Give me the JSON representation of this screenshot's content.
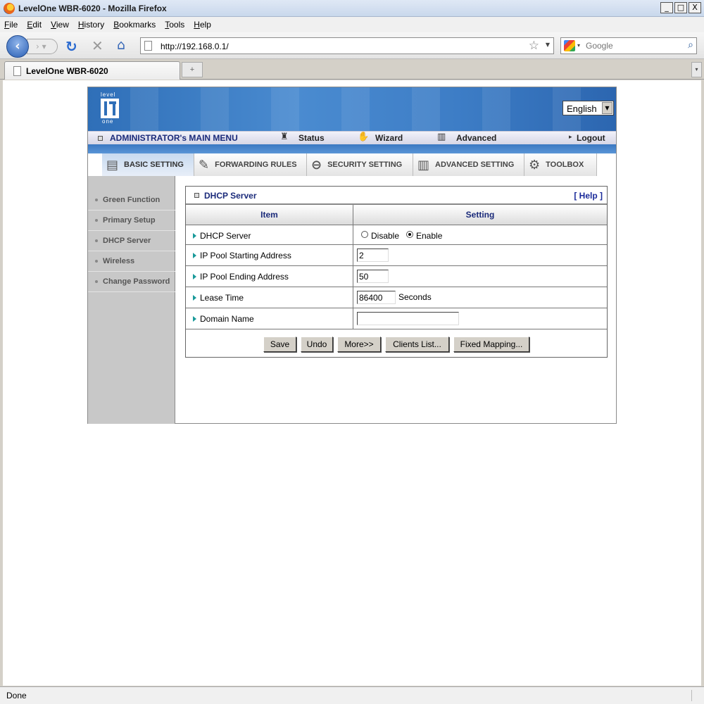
{
  "window": {
    "title": "LevelOne WBR-6020 - Mozilla Firefox",
    "minimize": "_",
    "maximize": "□",
    "close": "X"
  },
  "menubar": {
    "items": [
      {
        "first": "F",
        "rest": "ile"
      },
      {
        "first": "E",
        "rest": "dit"
      },
      {
        "first": "V",
        "rest": "iew"
      },
      {
        "first": "H",
        "rest": "istory"
      },
      {
        "first": "B",
        "rest": "ookmarks"
      },
      {
        "first": "T",
        "rest": "ools"
      },
      {
        "first": "H",
        "rest": "elp"
      }
    ]
  },
  "navbar": {
    "url": "http://192.168.0.1/",
    "search_placeholder": "Google"
  },
  "tabs": {
    "active_title": "LevelOne WBR-6020"
  },
  "router": {
    "logo": {
      "top": "level",
      "bottom": "one"
    },
    "language": "English",
    "admin_menu": {
      "title": "ADMINISTRATOR's MAIN MENU",
      "status": "Status",
      "wizard": "Wizard",
      "advanced": "Advanced",
      "logout": "Logout"
    },
    "nav_tabs": [
      {
        "label": "BASIC SETTING",
        "icon": "folder-icon"
      },
      {
        "label": "FORWARDING RULES",
        "icon": "forward-icon"
      },
      {
        "label": "SECURITY SETTING",
        "icon": "lock-icon"
      },
      {
        "label": "ADVANCED SETTING",
        "icon": "advanced-icon"
      },
      {
        "label": "TOOLBOX",
        "icon": "toolbox-icon"
      }
    ],
    "sidebar": [
      {
        "label": "Green Function"
      },
      {
        "label": "Primary Setup"
      },
      {
        "label": "DHCP Server"
      },
      {
        "label": "Wireless"
      },
      {
        "label": "Change Password"
      }
    ],
    "panel": {
      "title": "DHCP Server",
      "help": "[ Help ]",
      "col_item": "Item",
      "col_setting": "Setting",
      "rows": {
        "dhcp_server": {
          "label": "DHCP Server",
          "disable": "Disable",
          "enable": "Enable",
          "selected": "Enable"
        },
        "pool_start": {
          "label": "IP Pool Starting Address",
          "value": "2"
        },
        "pool_end": {
          "label": "IP Pool Ending Address",
          "value": "50"
        },
        "lease_time": {
          "label": "Lease Time",
          "value": "86400",
          "unit": "Seconds"
        },
        "domain_name": {
          "label": "Domain Name",
          "value": ""
        }
      },
      "buttons": {
        "save": "Save",
        "undo": "Undo",
        "more": "More>>",
        "clients": "Clients List...",
        "fixed": "Fixed Mapping..."
      }
    }
  },
  "statusbar": {
    "text": "Done"
  }
}
